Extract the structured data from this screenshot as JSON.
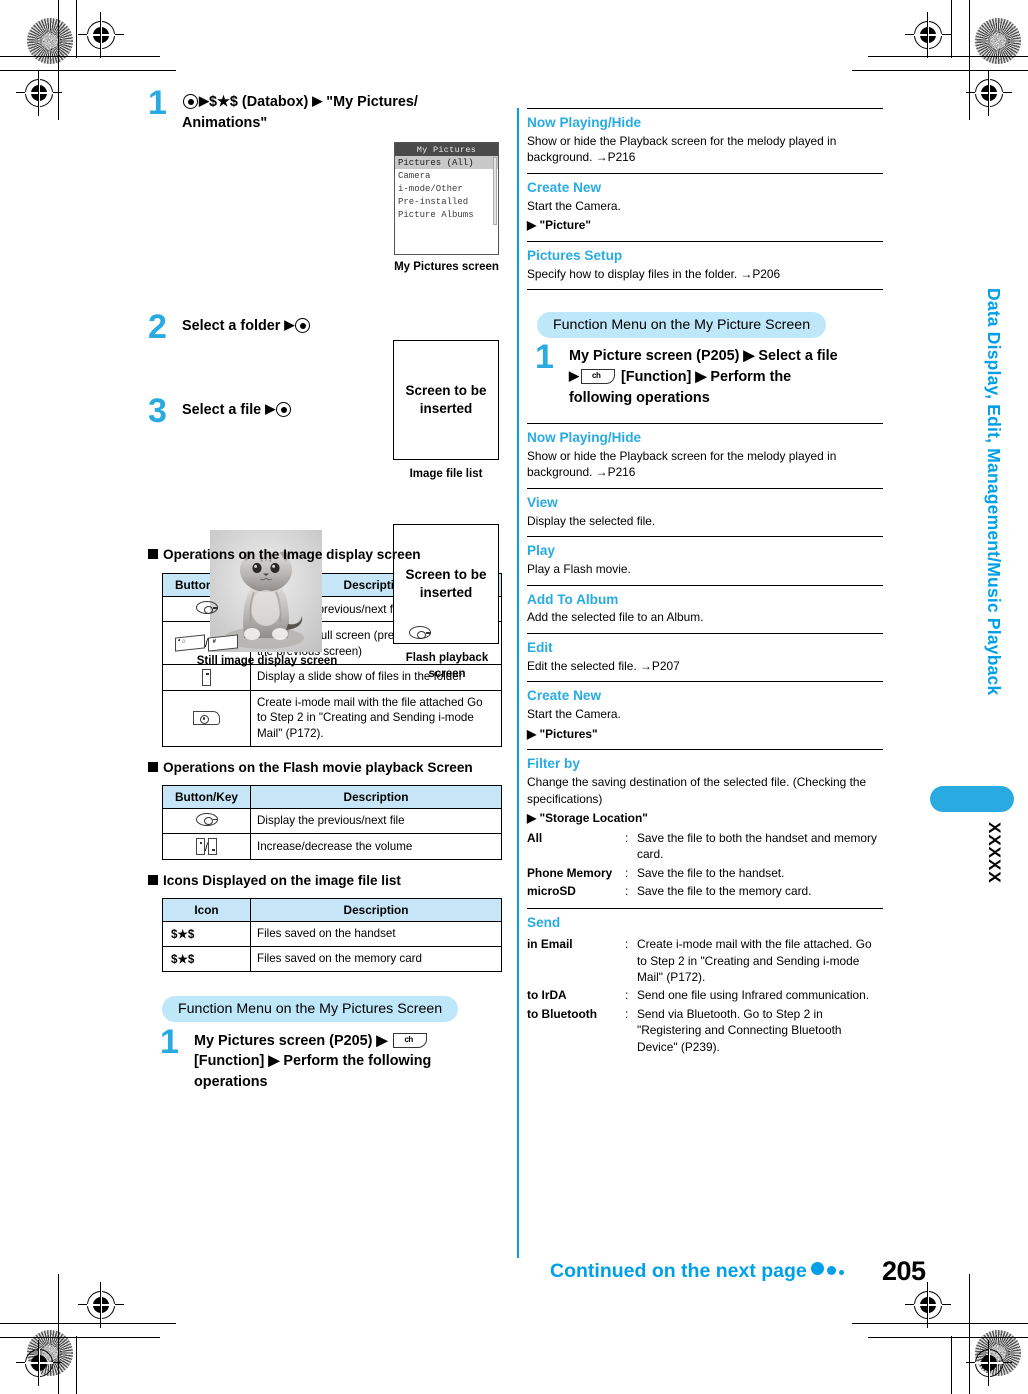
{
  "colors": {
    "accent": "#29abe2",
    "accent_dark": "#00a0e9",
    "pill_bg": "#bfe7fa",
    "table_header": "#c6e6f7"
  },
  "left_column": {
    "steps": [
      {
        "num": "1",
        "text_before_icon": "",
        "text": "$★$ (Databox) ▶ \"My Pictures/Animations\"",
        "line1_tail": "$★$ (Databox)",
        "line1_after": "\"My Pictures/",
        "line2": "Animations\""
      },
      {
        "num": "2",
        "text": "Select a folder"
      },
      {
        "num": "3",
        "text": "Select a file"
      }
    ],
    "phone_screen": {
      "title": "My Pictures",
      "items": [
        "Pictures (All)",
        "Camera",
        "i-mode/Other",
        "Pre-installed",
        "Picture Albums"
      ],
      "selected_index": 0,
      "caption": "My Pictures screen"
    },
    "insert_boxes": [
      {
        "label": "Screen to be inserted",
        "caption": "Image file list"
      },
      {
        "label": "Screen to be inserted",
        "caption": "Flash playback screen"
      }
    ],
    "still_image_caption": "Still image display screen",
    "sections": [
      {
        "heading": "Operations on the Image display screen",
        "table": {
          "headers": [
            "Button/Key",
            "Description"
          ],
          "rows": [
            {
              "key_icon": "nav-key-icon",
              "desc": "Display the previous/next file"
            },
            {
              "key_icon": "star-hash-key-icon",
              "desc": "Display the full screen (press ◄○► to restore the previous screen)"
            },
            {
              "key_icon": "side-key-icon",
              "desc": "Display a slide show of files in the folder"
            },
            {
              "key_icon": "mail-key-icon",
              "desc": "Create i-mode mail with the file attached Go to Step 2 in \"Creating and Sending i-mode Mail\" (P172)."
            }
          ]
        }
      },
      {
        "heading": "Operations on the Flash movie playback Screen",
        "table": {
          "headers": [
            "Button/Key",
            "Description"
          ],
          "rows": [
            {
              "key_icon": "nav-key-icon",
              "desc": "Display the previous/next file"
            },
            {
              "key_icon": "volume-key-icon",
              "desc": "Increase/decrease the volume"
            }
          ]
        }
      },
      {
        "heading": "Icons Displayed on the image file list",
        "table": {
          "headers": [
            "Icon",
            "Description"
          ],
          "rows": [
            {
              "icon_text": "$★$",
              "desc": "Files saved on the handset"
            },
            {
              "icon_text": "$★$",
              "desc": "Files saved on the memory card"
            }
          ]
        }
      }
    ],
    "function_menu": {
      "pill_label": "Function Menu on the My Pictures Screen",
      "step_num": "1",
      "step_line1": "My Pictures screen (P205) ▶",
      "func_key_label": "ch",
      "step_line2": "[Function] ▶ Perform the following",
      "step_line3": "operations"
    }
  },
  "right_column": {
    "top_items": [
      {
        "title": "Now Playing/Hide",
        "text": "Show or hide the Playback screen for the melody played in background. →P216"
      },
      {
        "title": "Create New",
        "text": "Start the Camera.",
        "sub": "▶ \"Picture\""
      },
      {
        "title": "Pictures Setup",
        "text": "Specify how to display files in the folder. →P206"
      }
    ],
    "function_menu": {
      "pill_label": "Function Menu on the My Picture Screen",
      "step_num": "1",
      "step_line1": "My Picture screen (P205) ▶ Select a file",
      "func_key_label": "ch",
      "step_line2": "[Function] ▶ Perform the",
      "step_line3": "following operations"
    },
    "items": [
      {
        "title": "Now Playing/Hide",
        "text": "Show or hide the Playback screen for the melody played in background. →P216"
      },
      {
        "title": "View",
        "text": "Display the selected file."
      },
      {
        "title": "Play",
        "text": "Play a Flash movie."
      },
      {
        "title": "Add To Album",
        "text": "Add the selected file to an Album."
      },
      {
        "title": "Edit",
        "text": "Edit the selected file. →P207"
      },
      {
        "title": "Create New",
        "text": "Start the Camera.",
        "sub": "▶ \"Pictures\""
      },
      {
        "title": "Filter by",
        "text": "Change the saving destination of the selected file. (Checking the specifications)",
        "sub": "▶ \"Storage Location\"",
        "defs": [
          {
            "term": "All",
            "colon": ":",
            "desc": "Save the file to both the handset and memory card."
          },
          {
            "term": "Phone Memory",
            "colon": ":",
            "desc": "Save the file to the handset."
          },
          {
            "term": "microSD",
            "colon": ":",
            "desc": "Save the file to the memory card."
          }
        ]
      },
      {
        "title": "Send",
        "defs": [
          {
            "term": "in Email",
            "colon": ":",
            "desc": "Create i-mode mail with the file attached. Go to Step 2 in \"Creating and Sending i-mode Mail\" (P172)."
          },
          {
            "term": "to IrDA",
            "colon": ":",
            "desc": "Send one file using Infrared communication."
          },
          {
            "term": "to Bluetooth",
            "colon": ":",
            "desc": "Send via Bluetooth. Go to Step 2 in \"Registering and Connecting Bluetooth Device\" (P239)."
          }
        ]
      }
    ]
  },
  "side_tab": {
    "vertical_label": "Data Display, Edit, Management/Music Playback",
    "marker": "XXXXX"
  },
  "footer": {
    "continued": "Continued on the next page",
    "page_number": "205"
  }
}
